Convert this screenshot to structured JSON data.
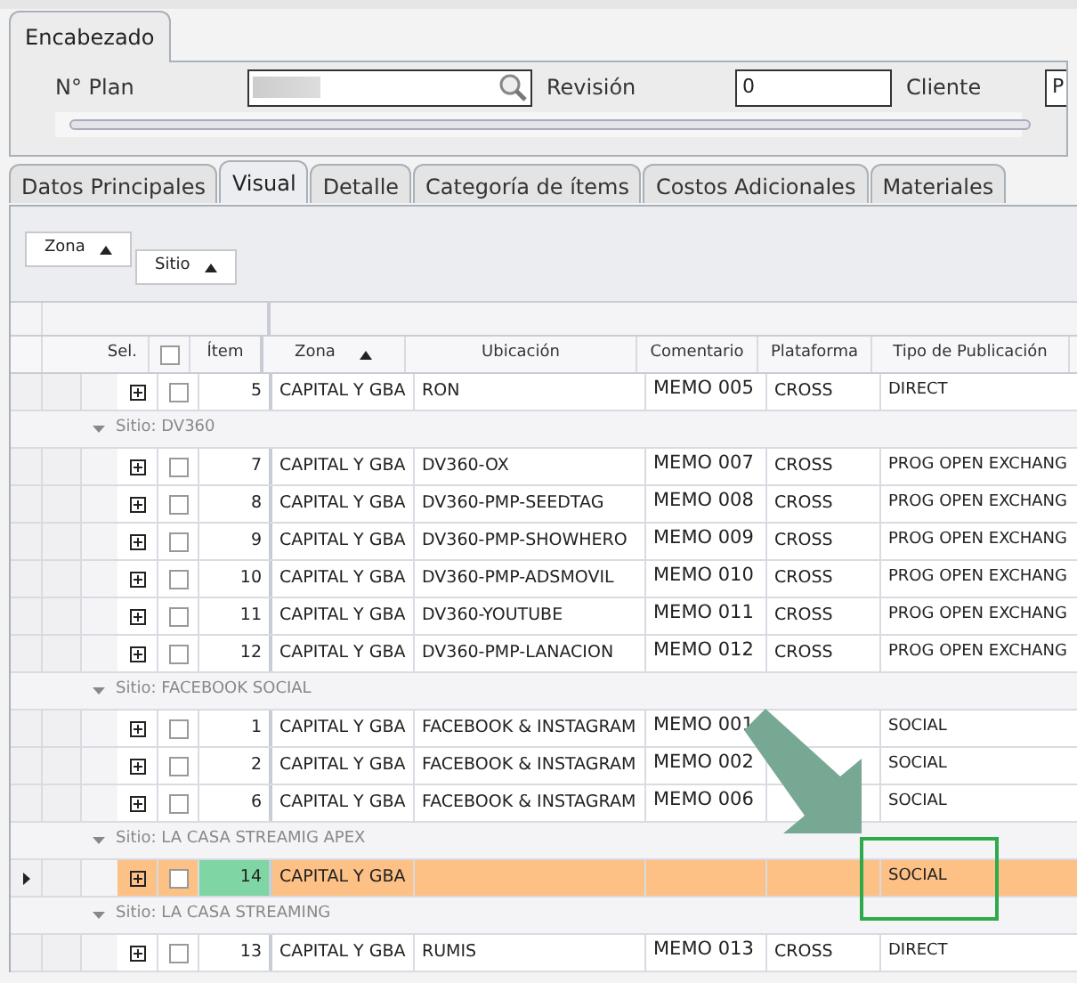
{
  "header_panel": {
    "tab": "Encabezado",
    "fields": [
      {
        "label": "N° Plan",
        "kind": "search"
      },
      {
        "label": "Revisión",
        "value": "0",
        "kind": "text"
      },
      {
        "label": "Cliente",
        "value": "P",
        "kind": "text"
      }
    ]
  },
  "tabs": [
    {
      "label": "Datos Principales",
      "selected": false
    },
    {
      "label": "Visual",
      "selected": true
    },
    {
      "label": "Detalle",
      "selected": false
    },
    {
      "label": "Categoría de ítems",
      "selected": false
    },
    {
      "label": "Costos Adicionales",
      "selected": false
    },
    {
      "label": "Materiales",
      "selected": false
    }
  ],
  "group_by": [
    "Zona",
    "Sitio"
  ],
  "table": {
    "select_all_checked": false,
    "columns": [
      "Sel.",
      "Ítem",
      "Zona",
      "Ubicación",
      "Comentario",
      "Plataforma",
      "Tipo de Publicación"
    ],
    "rows": [
      {
        "kind": "row",
        "item": "5",
        "zona": "CAPITAL Y GBA",
        "ubicacion": "RON",
        "comentario": "MEMO 005",
        "plataforma": "CROSS",
        "tipo": "DIRECT",
        "selected": false,
        "checked": false
      },
      {
        "kind": "group",
        "label": "Sitio: DV360",
        "expanded": true
      },
      {
        "kind": "row",
        "item": "7",
        "zona": "CAPITAL Y GBA",
        "ubicacion": "DV360-OX",
        "comentario": "MEMO 007",
        "plataforma": "CROSS",
        "tipo": "PROG OPEN EXCHANG",
        "selected": false,
        "checked": false
      },
      {
        "kind": "row",
        "item": "8",
        "zona": "CAPITAL Y GBA",
        "ubicacion": "DV360-PMP-SEEDTAG",
        "comentario": "MEMO 008",
        "plataforma": "CROSS",
        "tipo": "PROG OPEN EXCHANG",
        "selected": false,
        "checked": false
      },
      {
        "kind": "row",
        "item": "9",
        "zona": "CAPITAL Y GBA",
        "ubicacion": "DV360-PMP-SHOWHERO",
        "comentario": "MEMO 009",
        "plataforma": "CROSS",
        "tipo": "PROG OPEN EXCHANG",
        "selected": false,
        "checked": false
      },
      {
        "kind": "row",
        "item": "10",
        "zona": "CAPITAL Y GBA",
        "ubicacion": "DV360-PMP-ADSMOVIL",
        "comentario": "MEMO 010",
        "plataforma": "CROSS",
        "tipo": "PROG OPEN EXCHANG",
        "selected": false,
        "checked": false
      },
      {
        "kind": "row",
        "item": "11",
        "zona": "CAPITAL Y GBA",
        "ubicacion": "DV360-YOUTUBE",
        "comentario": "MEMO 011",
        "plataforma": "CROSS",
        "tipo": "PROG OPEN EXCHANG",
        "selected": false,
        "checked": false
      },
      {
        "kind": "row",
        "item": "12",
        "zona": "CAPITAL Y GBA",
        "ubicacion": "DV360-PMP-LANACION",
        "comentario": "MEMO 012",
        "plataforma": "CROSS",
        "tipo": "PROG OPEN EXCHANG",
        "selected": false,
        "checked": false
      },
      {
        "kind": "group",
        "label": "Sitio: FACEBOOK SOCIAL",
        "expanded": true
      },
      {
        "kind": "row",
        "item": "1",
        "zona": "CAPITAL Y GBA",
        "ubicacion": "FACEBOOK & INSTAGRAM",
        "comentario": "MEMO 001",
        "tipo": "SOCIAL",
        "selected": false,
        "checked": false
      },
      {
        "kind": "row",
        "item": "2",
        "zona": "CAPITAL Y GBA",
        "ubicacion": "FACEBOOK & INSTAGRAM",
        "comentario": "MEMO 002",
        "tipo": "SOCIAL",
        "selected": false,
        "checked": false
      },
      {
        "kind": "row",
        "item": "6",
        "zona": "CAPITAL Y GBA",
        "ubicacion": "FACEBOOK & INSTAGRAM",
        "comentario": "MEMO 006",
        "tipo": "SOCIAL",
        "selected": false,
        "checked": false
      },
      {
        "kind": "group",
        "label": "Sitio: LA CASA STREAMIG APEX",
        "expanded": true
      },
      {
        "kind": "row",
        "item": "14",
        "zona": "CAPITAL Y GBA",
        "tipo": "SOCIAL",
        "selected": true,
        "checked": false
      },
      {
        "kind": "group",
        "label": "Sitio: LA CASA STREAMING",
        "expanded": true
      },
      {
        "kind": "row",
        "item": "13",
        "zona": "CAPITAL Y GBA",
        "ubicacion": "RUMIS",
        "comentario": "MEMO 013",
        "plataforma": "CROSS",
        "tipo": "DIRECT",
        "selected": false,
        "checked": false
      }
    ]
  }
}
